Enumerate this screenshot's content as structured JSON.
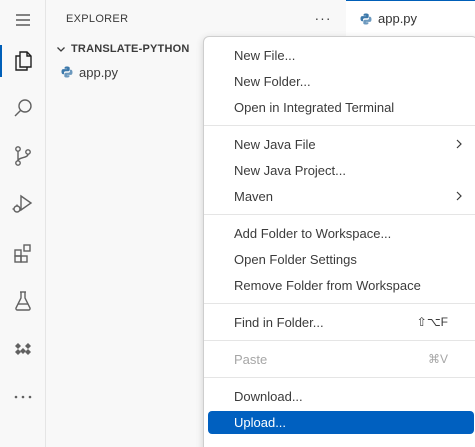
{
  "activity_bar": {
    "items": [
      {
        "name": "menu",
        "icon": "hamburger-icon"
      },
      {
        "name": "explorer",
        "icon": "files-icon",
        "active": true
      },
      {
        "name": "search",
        "icon": "search-icon"
      },
      {
        "name": "source-control",
        "icon": "source-control-icon"
      },
      {
        "name": "run-debug",
        "icon": "run-debug-icon"
      },
      {
        "name": "extensions",
        "icon": "extensions-icon"
      },
      {
        "name": "testing",
        "icon": "flask-icon"
      },
      {
        "name": "remote",
        "icon": "remote-icon"
      },
      {
        "name": "more",
        "icon": "more-icon"
      }
    ]
  },
  "sidebar": {
    "title": "EXPLORER",
    "more_label": "···",
    "folder": "TRANSLATE-PYTHON",
    "files": [
      "app.py"
    ]
  },
  "editor": {
    "tab_label": "app.py"
  },
  "context_menu": {
    "items": {
      "new_file": "New File...",
      "new_folder": "New Folder...",
      "open_terminal": "Open in Integrated Terminal",
      "new_java_file": "New Java File",
      "new_java_project": "New Java Project...",
      "maven": "Maven",
      "add_folder": "Add Folder to Workspace...",
      "open_folder_settings": "Open Folder Settings",
      "remove_folder": "Remove Folder from Workspace",
      "find_in_folder": "Find in Folder...",
      "find_in_folder_kbd": "⇧⌥F",
      "paste": "Paste",
      "paste_kbd": "⌘V",
      "download": "Download...",
      "upload": "Upload..."
    },
    "selected_item": "Upload..."
  },
  "colors": {
    "accent": "#005fb8",
    "selection": "#0060c0",
    "python_icon": "#3c78aa"
  }
}
